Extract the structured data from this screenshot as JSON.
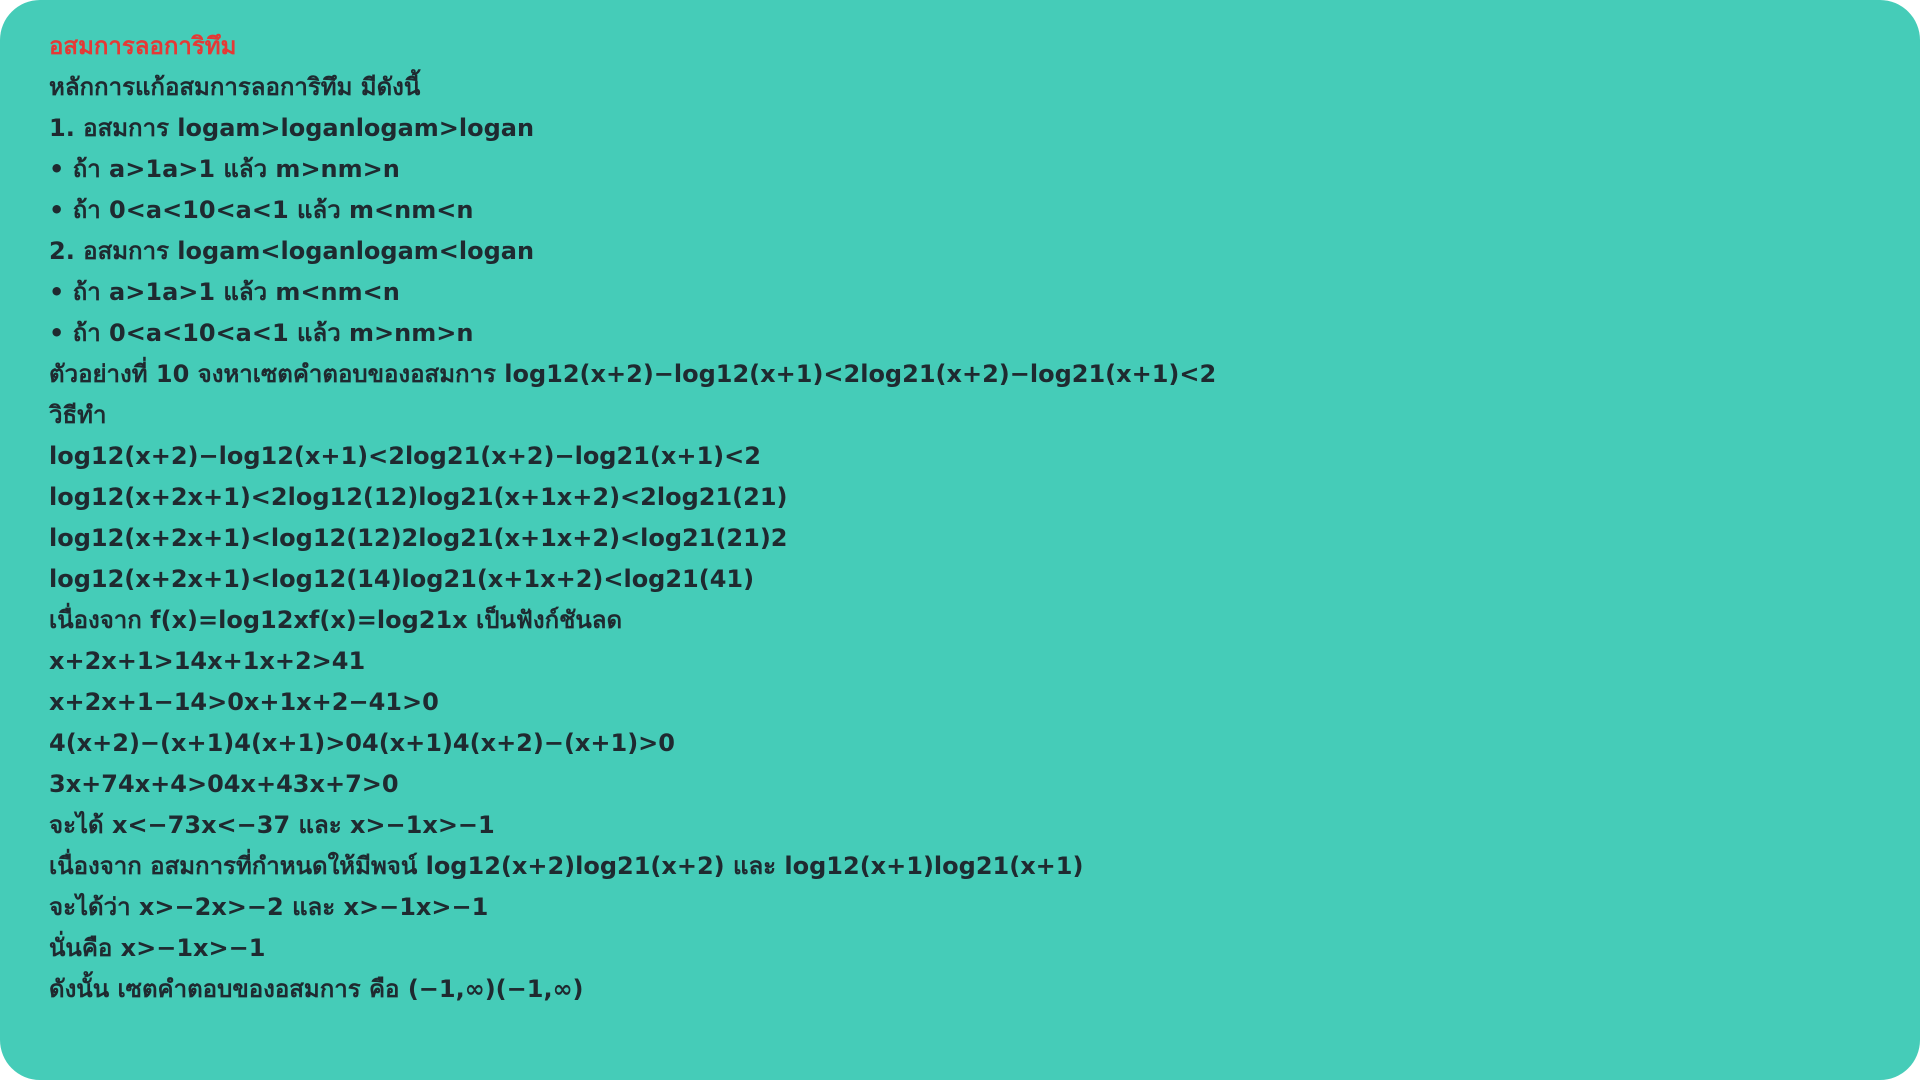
{
  "document": {
    "title": "อสมการลอการิทึม",
    "title_color": "#e53935",
    "text_color": "#1f2a30",
    "background_color": "#45ccb8",
    "lines": [
      "หลักการแก้อสมการลอการิทึม มีดังนี้",
      "1. อสมการ logam>loganlogam>logan",
      "• ถ้า a>1a>1 แล้ว m>nm>n",
      "• ถ้า 0<a<10<a<1 แล้ว m<nm<n",
      "2. อสมการ logam<loganlogam<logan",
      "• ถ้า a>1a>1 แล้ว m<nm<n",
      "• ถ้า 0<a<10<a<1 แล้ว m>nm>n",
      "ตัวอย่างที่ 10 จงหาเซตคำตอบของอสมการ log12(x+2)−log12(x+1)<2log21(x+2)−log21(x+1)<2",
      "วิธีทำ",
      "log12(x+2)−log12(x+1)<2log21(x+2)−log21(x+1)<2",
      "log12(x+2x+1)<2log12(12)log21(x+1x+2)<2log21(21)",
      "log12(x+2x+1)<log12(12)2log21(x+1x+2)<log21(21)2",
      "log12(x+2x+1)<log12(14)log21(x+1x+2)<log21(41)",
      "เนื่องจาก f(x)=log12xf(x)=log21x เป็นฟังก์ชันลด",
      "x+2x+1>14x+1x+2>41",
      "x+2x+1−14>0x+1x+2−41>0",
      "4(x+2)−(x+1)4(x+1)>04(x+1)4(x+2)−(x+1)>0",
      "3x+74x+4>04x+43x+7>0",
      "จะได้ x<−73x<−37 และ x>−1x>−1",
      "เนื่องจาก อสมการที่กำหนดให้มีพจน์ log12(x+2)log21(x+2) และ log12(x+1)log21(x+1)",
      "จะได้ว่า x>−2x>−2 และ x>−1x>−1",
      "นั่นคือ x>−1x>−1",
      "ดังนั้น เซตคำตอบของอสมการ คือ (−1,∞)(−1,∞)"
    ]
  }
}
